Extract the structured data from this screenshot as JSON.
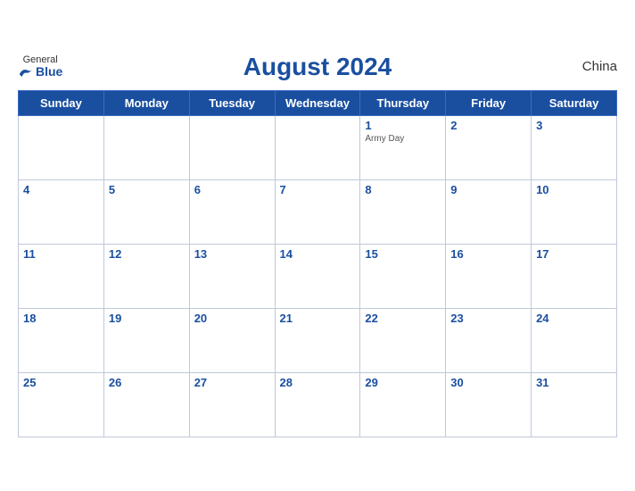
{
  "header": {
    "title": "August 2024",
    "logo_general": "General",
    "logo_blue": "Blue",
    "country": "China"
  },
  "weekdays": [
    "Sunday",
    "Monday",
    "Tuesday",
    "Wednesday",
    "Thursday",
    "Friday",
    "Saturday"
  ],
  "weeks": [
    [
      {
        "day": "",
        "empty": true
      },
      {
        "day": "",
        "empty": true
      },
      {
        "day": "",
        "empty": true
      },
      {
        "day": "",
        "empty": true
      },
      {
        "day": "1",
        "event": "Army Day"
      },
      {
        "day": "2"
      },
      {
        "day": "3"
      }
    ],
    [
      {
        "day": "4"
      },
      {
        "day": "5"
      },
      {
        "day": "6"
      },
      {
        "day": "7"
      },
      {
        "day": "8"
      },
      {
        "day": "9"
      },
      {
        "day": "10"
      }
    ],
    [
      {
        "day": "11"
      },
      {
        "day": "12"
      },
      {
        "day": "13"
      },
      {
        "day": "14"
      },
      {
        "day": "15"
      },
      {
        "day": "16"
      },
      {
        "day": "17"
      }
    ],
    [
      {
        "day": "18"
      },
      {
        "day": "19"
      },
      {
        "day": "20"
      },
      {
        "day": "21"
      },
      {
        "day": "22"
      },
      {
        "day": "23"
      },
      {
        "day": "24"
      }
    ],
    [
      {
        "day": "25"
      },
      {
        "day": "26"
      },
      {
        "day": "27"
      },
      {
        "day": "28"
      },
      {
        "day": "29"
      },
      {
        "day": "30"
      },
      {
        "day": "31"
      }
    ]
  ]
}
